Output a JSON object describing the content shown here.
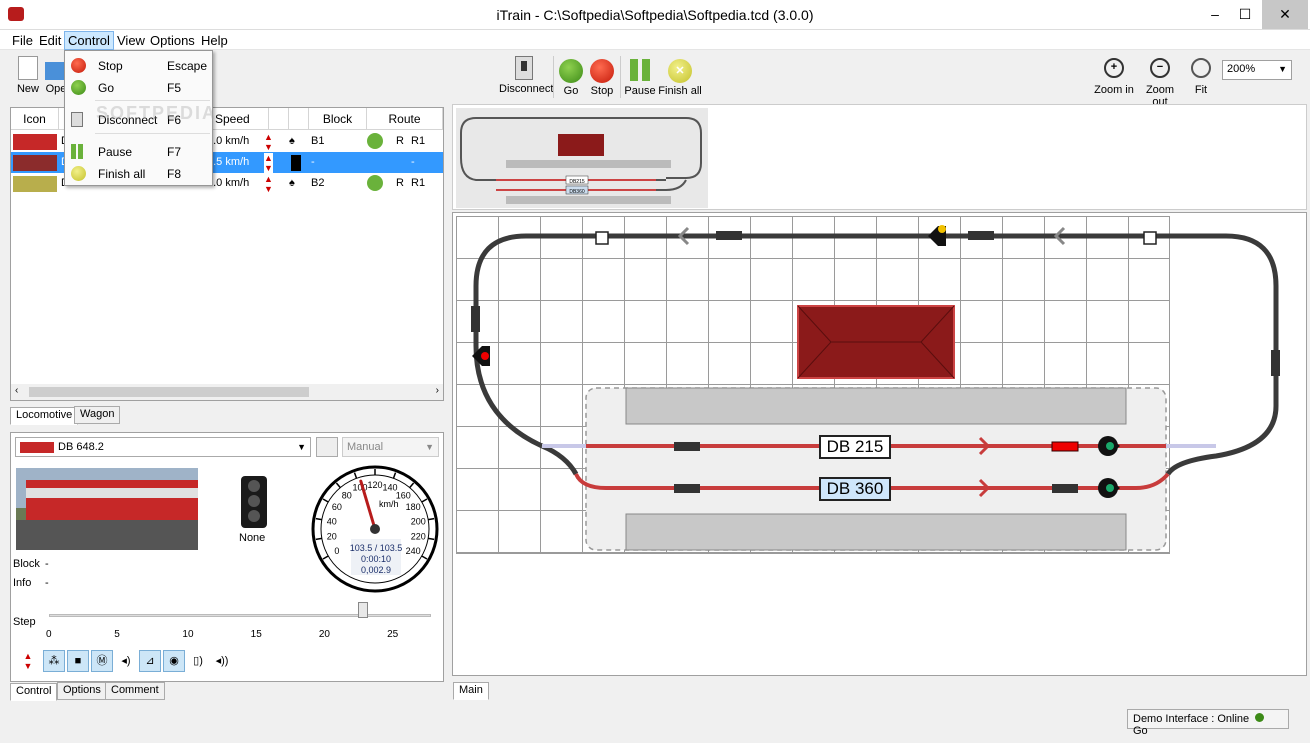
{
  "window": {
    "title": "iTrain - C:\\Softpedia\\Softpedia\\Softpedia.tcd (3.0.0)",
    "min": "–",
    "max": "☐",
    "close": "✕"
  },
  "menubar": [
    {
      "label": "File"
    },
    {
      "label": "Edit"
    },
    {
      "label": "Control"
    },
    {
      "label": "View"
    },
    {
      "label": "Options"
    },
    {
      "label": "Help"
    }
  ],
  "control_menu": [
    {
      "label": "Stop",
      "key": "Escape"
    },
    {
      "label": "Go",
      "key": "F5"
    },
    {
      "label": "Disconnect",
      "key": "F6"
    },
    {
      "label": "Pause",
      "key": "F7"
    },
    {
      "label": "Finish all",
      "key": "F8"
    }
  ],
  "toolbar": {
    "left": [
      {
        "label": "New"
      },
      {
        "label": "Ope"
      }
    ],
    "center": [
      {
        "label": "Disconnect"
      },
      {
        "label": "Go"
      },
      {
        "label": "Stop"
      },
      {
        "label": "Pause"
      },
      {
        "label": "Finish all"
      }
    ],
    "right": [
      {
        "label": "Zoom in"
      },
      {
        "label": "Zoom out"
      },
      {
        "label": "Fit"
      }
    ],
    "zoom_value": "200%"
  },
  "loco_table": {
    "headers": [
      "Icon",
      "Speed",
      "Block",
      "Route"
    ],
    "rows": [
      {
        "name": "D",
        "speed": "0.0 km/h",
        "block": "B1",
        "route_dir": "R",
        "route": "R1"
      },
      {
        "name": "D",
        "speed": "3.5 km/h",
        "block": "-",
        "route_dir": "",
        "route": "-"
      },
      {
        "name": "DB 230",
        "speed": "0.0 km/h",
        "block": "B2",
        "route_dir": "R",
        "route": "R1"
      }
    ],
    "tabs": [
      "Locomotive",
      "Wagon"
    ]
  },
  "control_panel": {
    "selected_loco": "DB 648.2",
    "mode": "Manual",
    "signal_label": "None",
    "block_label": "Block",
    "block_value": "-",
    "info_label": "Info",
    "info_value": "-",
    "speedo": {
      "unit": "km/h",
      "ticks": [
        "0",
        "20",
        "40",
        "60",
        "80",
        "100",
        "120",
        "140",
        "160",
        "180",
        "200",
        "220",
        "240"
      ],
      "speed": "103.5 / 103.5",
      "time": "0:00:10",
      "distance": "0,002.9",
      "needle_value": 103.5
    },
    "step_label": "Step",
    "step_ticks": [
      "0",
      "5",
      "10",
      "15",
      "20",
      "25"
    ],
    "step_value": 23,
    "tabs": [
      "Control",
      "Options",
      "Comment"
    ]
  },
  "layout": {
    "blocks": [
      {
        "label": "DB 215"
      },
      {
        "label": "DB 360"
      }
    ],
    "tab": "Main",
    "overview_labels": [
      "DB215",
      "DB360"
    ]
  },
  "statusbar": {
    "text": "Demo Interface :  Online",
    "state": "Go"
  },
  "watermark": "SOFTPEDIA"
}
